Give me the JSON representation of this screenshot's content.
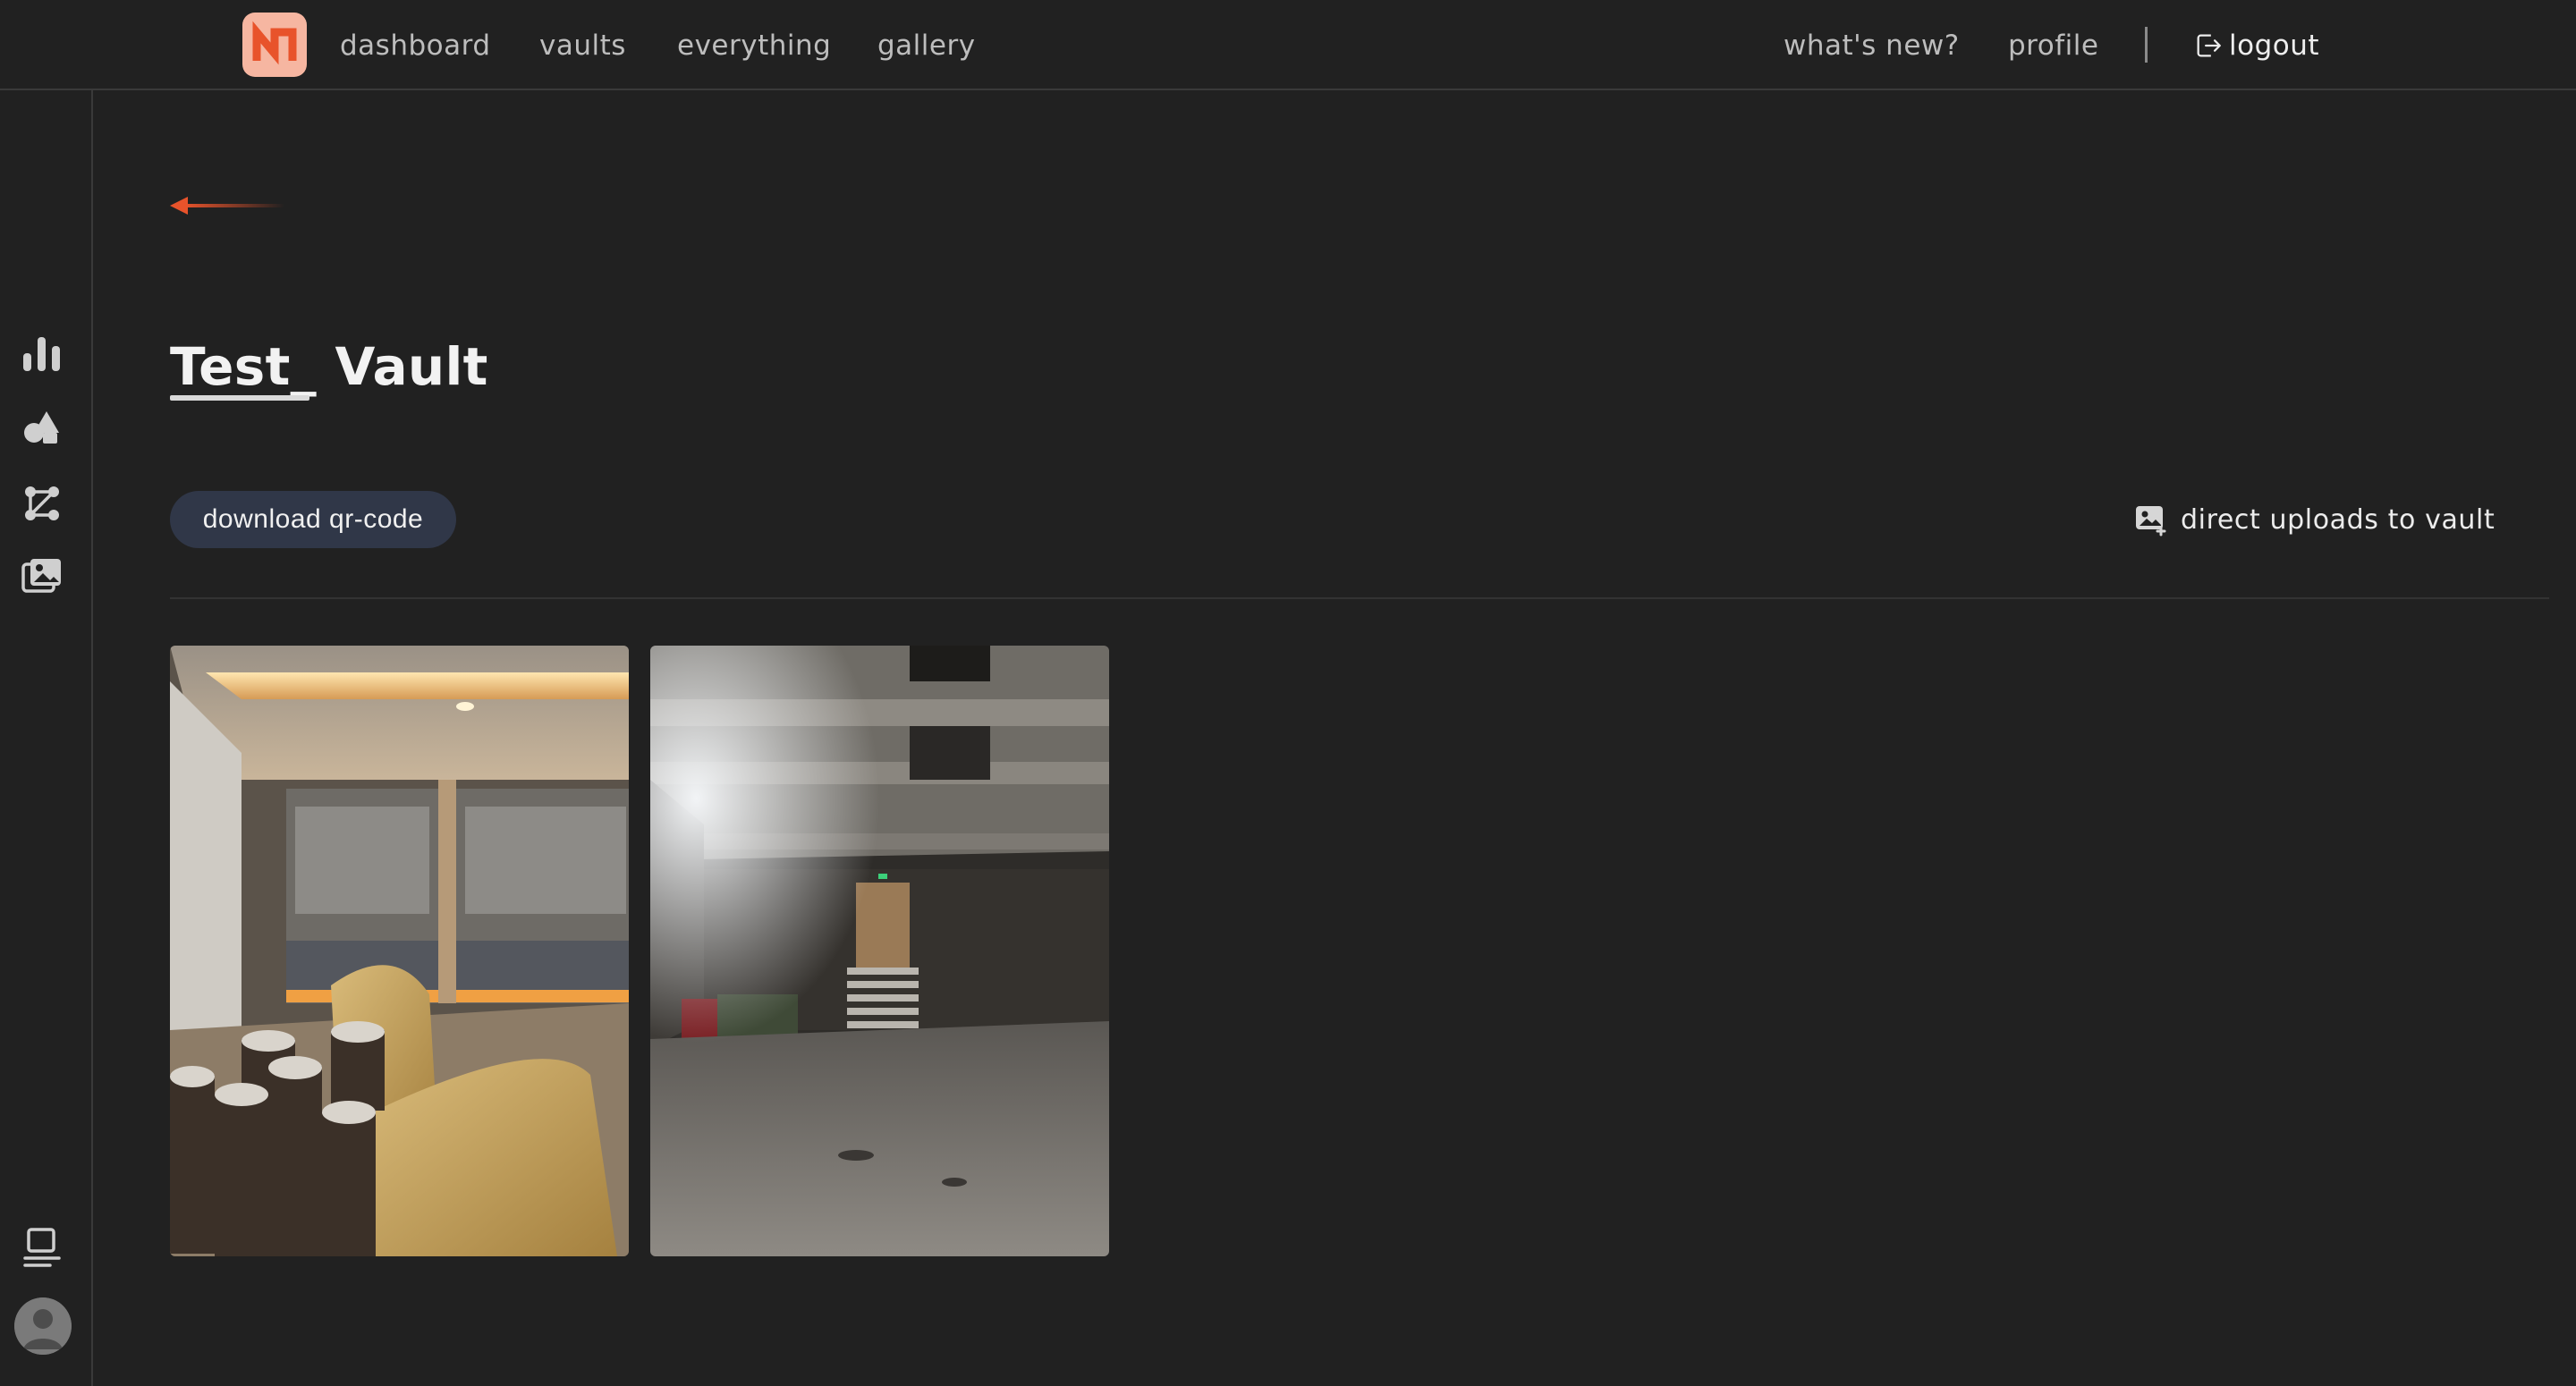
{
  "app": {
    "logo_icon": "n-logo-icon",
    "accent_color": "#e8532b"
  },
  "nav": {
    "left": [
      "dashboard",
      "vaults",
      "everything",
      "gallery"
    ],
    "right": [
      "what's new?",
      "profile"
    ],
    "logout_label": "logout"
  },
  "rail": {
    "icons": [
      "bar-chart-icon",
      "shapes-icon",
      "graph-nodes-icon",
      "image-gallery-icon"
    ],
    "bottom_icons": [
      "panel-layout-icon",
      "avatar-icon"
    ]
  },
  "vault": {
    "title": "Test_ Vault",
    "download_label": "download qr-code",
    "direct_label": "direct uploads to vault"
  },
  "gallery": {
    "photos": [
      {
        "alt": "lounge-room-photo"
      },
      {
        "alt": "concrete-basement-photo"
      }
    ]
  }
}
